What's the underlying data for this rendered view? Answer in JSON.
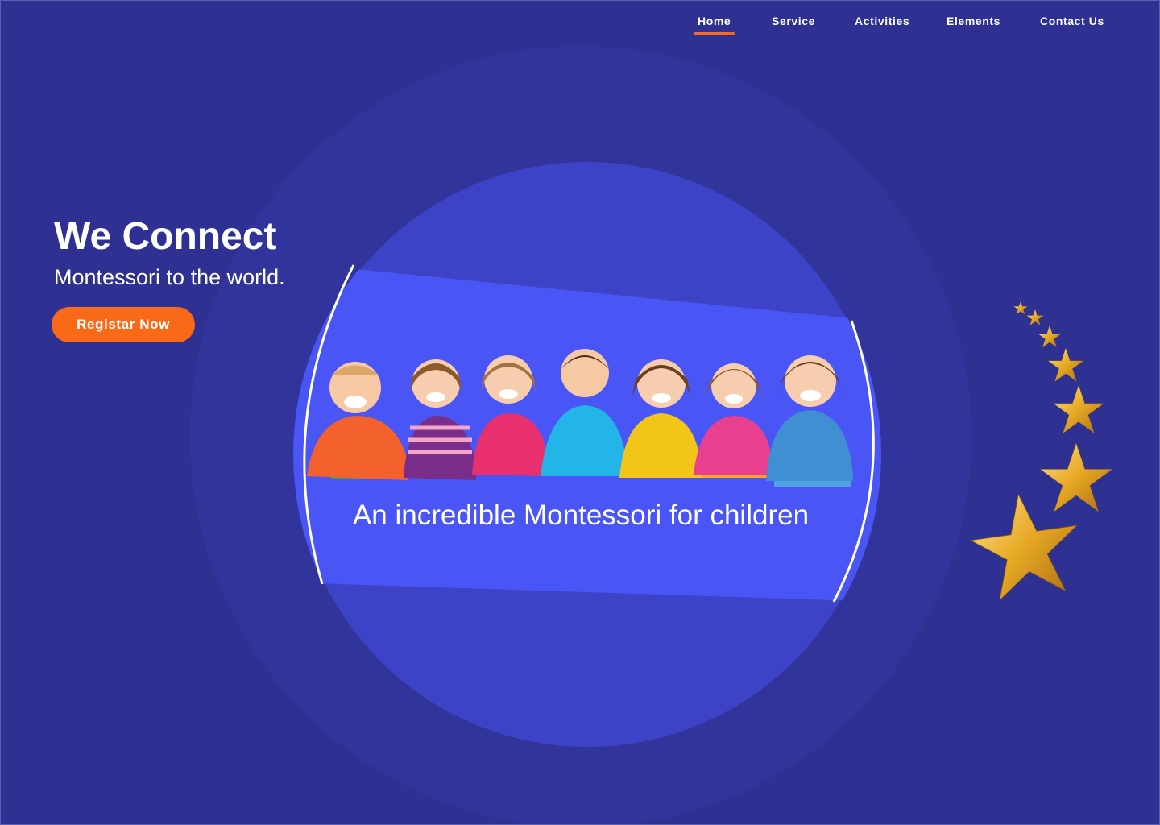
{
  "nav": {
    "items": [
      {
        "label": "Home",
        "active": true
      },
      {
        "label": "Service",
        "active": false
      },
      {
        "label": "Activities",
        "active": false
      },
      {
        "label": "Elements",
        "active": false
      },
      {
        "label": "Contact Us",
        "active": false
      }
    ]
  },
  "hero": {
    "title": "We Connect",
    "subtitle": "Montessori to the world.",
    "cta_label": "Registar Now"
  },
  "banner": {
    "caption": "An incredible Montessori for children"
  },
  "colors": {
    "background": "#2e3191",
    "outer_circle": "#31359b",
    "inner_circle": "#3d43c6",
    "band": "#4a55f5",
    "accent": "#f86a18",
    "text": "#ffffff",
    "star_gold": "#e6a823"
  },
  "icons": {
    "stars": "gold-stars-decoration",
    "children": "children-group-photo"
  }
}
